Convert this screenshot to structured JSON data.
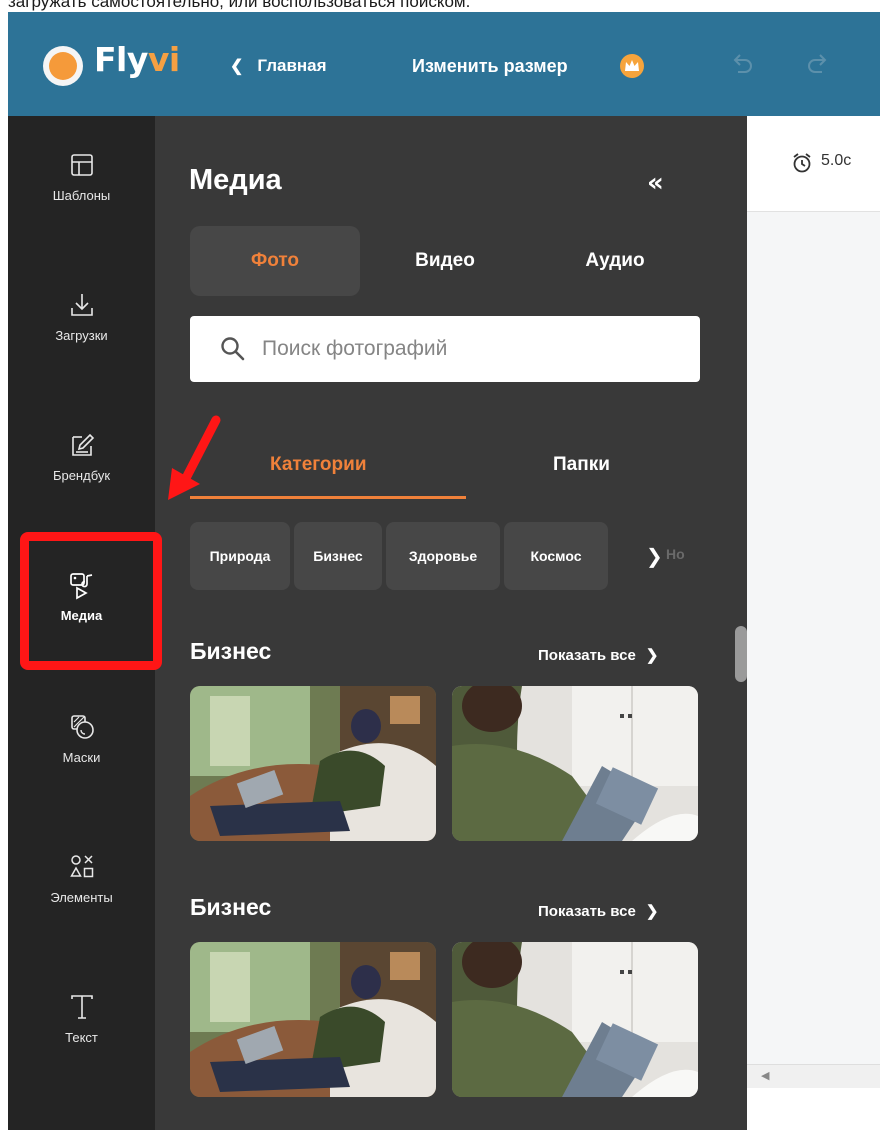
{
  "document": {
    "cutoff_text": "загружать самостоятельно, или воспользоваться поиском."
  },
  "topbar": {
    "logo_text_main": "Fly",
    "logo_text_accent": "vi",
    "back_label": "Главная",
    "resize_label": "Изменить размер",
    "colors": {
      "bg": "#2d7397",
      "accent": "#f59a3a"
    }
  },
  "rail": {
    "items": [
      {
        "label": "Шаблоны",
        "icon": "layout-icon"
      },
      {
        "label": "Загрузки",
        "icon": "download-icon"
      },
      {
        "label": "Брендбук",
        "icon": "brandbook-edit-icon"
      },
      {
        "label": "Медиа",
        "icon": "media-icon",
        "active": true
      },
      {
        "label": "Маски",
        "icon": "masks-icon"
      },
      {
        "label": "Элементы",
        "icon": "shapes-icon"
      },
      {
        "label": "Текст",
        "icon": "text-icon"
      }
    ]
  },
  "panel": {
    "title": "Медиа",
    "collapse_icon": "«",
    "media_tabs": [
      "Фото",
      "Видео",
      "Аудио"
    ],
    "selected_media_tab": "Фото",
    "search_placeholder": "Поиск фотографий",
    "sub_tabs": [
      "Категории",
      "Папки"
    ],
    "selected_sub_tab": "Категории",
    "chips": [
      "Природа",
      "Бизнес",
      "Здоровье",
      "Космос",
      "Но"
    ],
    "sections": [
      {
        "title": "Бизнес",
        "show_all": "Показать все"
      },
      {
        "title": "Бизнес",
        "show_all": "Показать все"
      }
    ],
    "accent_color": "#f0813a"
  },
  "canvas": {
    "duration": "5.0с"
  }
}
